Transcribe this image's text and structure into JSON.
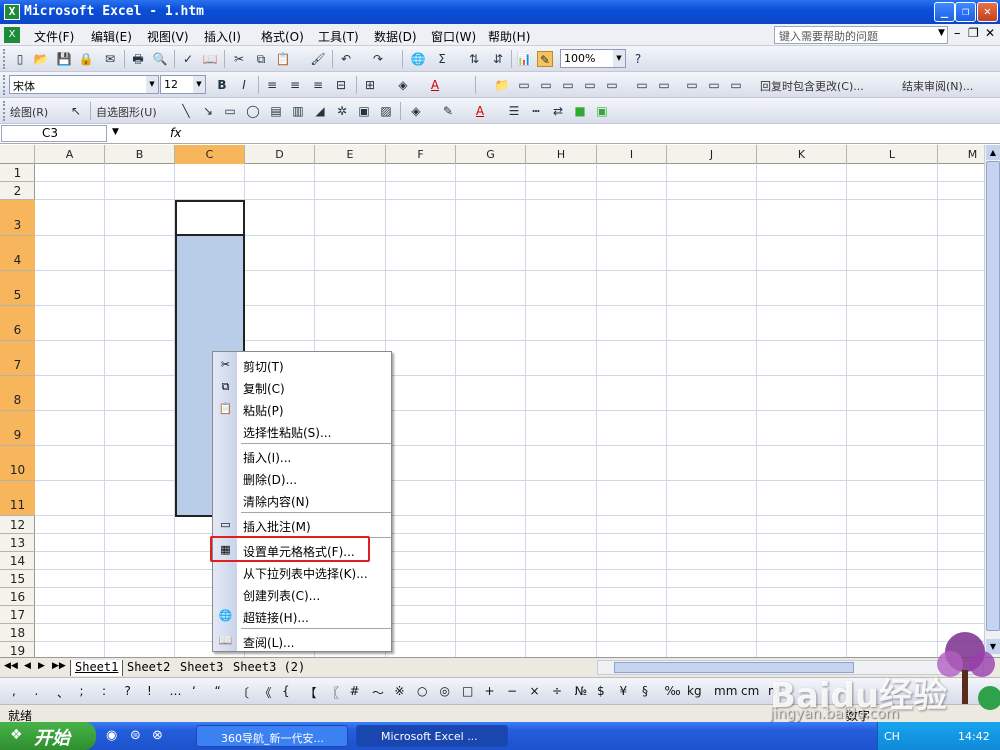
{
  "window": {
    "title": "Microsoft Excel - 1.htm",
    "app_icon_glyph": "X"
  },
  "menu": [
    {
      "label": "文件(F)"
    },
    {
      "label": "编辑(E)"
    },
    {
      "label": "视图(V)"
    },
    {
      "label": "插入(I)"
    },
    {
      "label": "格式(O)"
    },
    {
      "label": "工具(T)"
    },
    {
      "label": "数据(D)"
    },
    {
      "label": "窗口(W)"
    },
    {
      "label": "帮助(H)"
    }
  ],
  "help_box": {
    "placeholder": "键入需要帮助的问题"
  },
  "toolbar": {
    "zoom": "100%",
    "font_name": "宋体",
    "font_size": "12",
    "review_text": "回复时包含更改(C)...",
    "end_review": "结束审阅(N)...",
    "draw_label": "绘图(R)",
    "autoshape_label": "自选图形(U)"
  },
  "formula_bar": {
    "name_box": "C3",
    "fx": "fx",
    "value": ""
  },
  "columns": [
    "A",
    "B",
    "C",
    "D",
    "E",
    "F",
    "G",
    "H",
    "I",
    "J",
    "K",
    "L",
    "M"
  ],
  "rows": [
    "1",
    "2",
    "3",
    "4",
    "5",
    "6",
    "7",
    "8",
    "9",
    "10",
    "11",
    "12",
    "13",
    "14",
    "15",
    "16",
    "17",
    "18",
    "19"
  ],
  "selected": {
    "column": "C",
    "active_cell": "C3",
    "range": "C3:C11"
  },
  "sheet_tabs": [
    {
      "label": "Sheet1",
      "active": true
    },
    {
      "label": "Sheet2",
      "active": false
    },
    {
      "label": "Sheet3",
      "active": false
    },
    {
      "label": "Sheet3 (2)",
      "active": false
    }
  ],
  "symbols": [
    ",",
    ".",
    "、",
    ";",
    ":",
    "?",
    "!",
    "…",
    "‘",
    "“",
    "〔",
    "《",
    "{",
    "【",
    "〖",
    "#",
    "～",
    "※",
    "○",
    "◎",
    "□",
    "+",
    "−",
    "×",
    "÷",
    "№",
    "$",
    "¥",
    "§",
    "‰",
    "kg",
    "mm",
    "cm",
    "m"
  ],
  "context_menu": {
    "items": [
      {
        "label": "剪切(T)",
        "icon": "scissors-icon"
      },
      {
        "label": "复制(C)",
        "icon": "copy-icon"
      },
      {
        "label": "粘贴(P)",
        "icon": "paste-icon"
      },
      {
        "label": "选择性粘贴(S)...",
        "icon": ""
      },
      {
        "label": "插入(I)...",
        "icon": ""
      },
      {
        "label": "删除(D)...",
        "icon": ""
      },
      {
        "label": "清除内容(N)",
        "icon": ""
      },
      {
        "label": "插入批注(M)",
        "icon": "comment-icon"
      },
      {
        "label": "设置单元格格式(F)...",
        "icon": "format-cells-icon"
      },
      {
        "label": "从下拉列表中选择(K)...",
        "icon": ""
      },
      {
        "label": "创建列表(C)...",
        "icon": ""
      },
      {
        "label": "超链接(H)...",
        "icon": "hyperlink-icon"
      },
      {
        "label": "查阅(L)...",
        "icon": "research-icon"
      }
    ],
    "highlighted": "设置单元格格式(F)..."
  },
  "status": {
    "ready": "就绪",
    "mode": "数字"
  },
  "taskbar": {
    "start": "开始",
    "tasks": [
      {
        "label": "360导航_新一代安...",
        "active": false
      },
      {
        "label": "Microsoft Excel ...",
        "active": true
      }
    ],
    "tray": {
      "lang": "CH",
      "time": "14:42"
    }
  },
  "watermark": {
    "text": "Baidu经验",
    "url": "jingyan.baidu.com"
  },
  "colors": {
    "title_bar": "#0a4fd8",
    "selection": "#b9cde8",
    "header_selected": "#f7b55c",
    "highlight_box": "#e02020",
    "start_button": "#3a9a3c"
  }
}
